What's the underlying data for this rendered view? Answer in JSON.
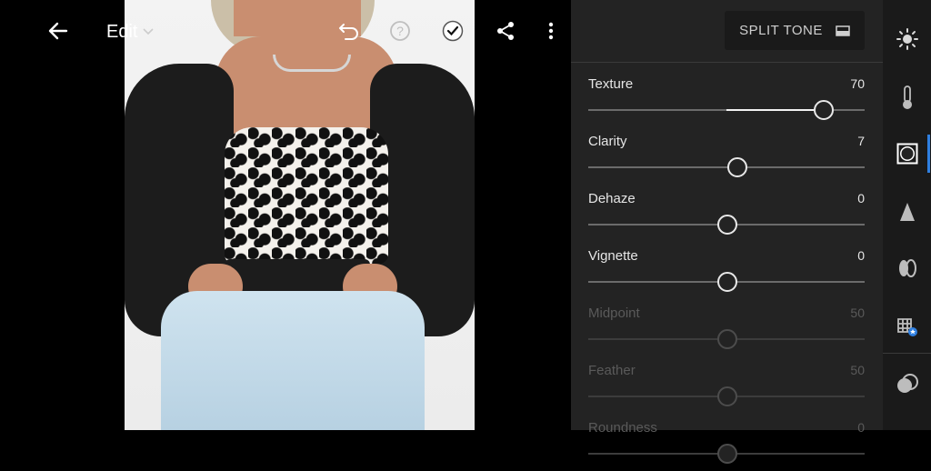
{
  "toolbar": {
    "title": "Edit",
    "icons": [
      "back-arrow-icon",
      "undo-icon",
      "help-icon",
      "checkmark-icon",
      "share-icon",
      "more-vertical-icon"
    ]
  },
  "panel": {
    "header_button": "SPLIT TONE",
    "sliders": [
      {
        "label": "Texture",
        "value": "70",
        "position": 0.85,
        "enabled": true
      },
      {
        "label": "Clarity",
        "value": "7",
        "position": 0.535,
        "enabled": true
      },
      {
        "label": "Dehaze",
        "value": "0",
        "position": 0.5,
        "enabled": true
      },
      {
        "label": "Vignette",
        "value": "0",
        "position": 0.5,
        "enabled": true
      },
      {
        "label": "Midpoint",
        "value": "50",
        "position": 0.5,
        "enabled": false
      },
      {
        "label": "Feather",
        "value": "50",
        "position": 0.5,
        "enabled": false
      },
      {
        "label": "Roundness",
        "value": "0",
        "position": 0.5,
        "enabled": false
      }
    ]
  },
  "tools": [
    "light-icon",
    "color-icon",
    "effects-icon",
    "detail-icon",
    "optics-icon",
    "geometry-icon",
    "presets-icon"
  ],
  "colors": {
    "accent": "#2f7fe0",
    "panel": "#232323",
    "rail": "#1a1a1a"
  }
}
